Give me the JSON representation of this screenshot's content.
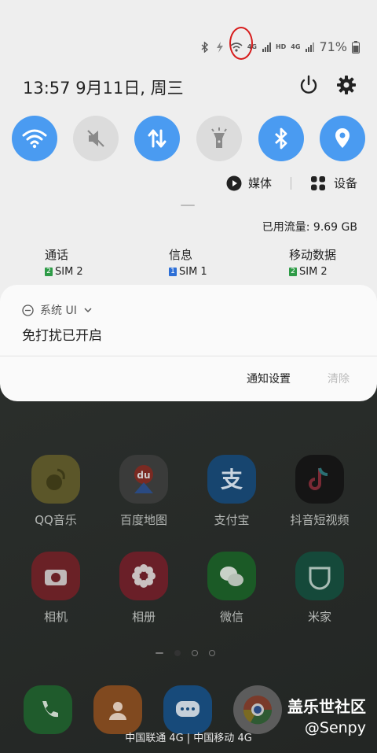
{
  "status_bar": {
    "battery_percent": "71%",
    "network_hd": "HD",
    "network_4g_1": "4G",
    "network_4g_2": "4G"
  },
  "header": {
    "time_date": "13:57  9月11日, 周三"
  },
  "quick_settings": [
    {
      "name": "wifi",
      "icon": "wifi-icon",
      "state": "on"
    },
    {
      "name": "sound",
      "icon": "mute-icon",
      "state": "off"
    },
    {
      "name": "mobile-data",
      "icon": "data-transfer-icon",
      "state": "on"
    },
    {
      "name": "flashlight",
      "icon": "flashlight-icon",
      "state": "off"
    },
    {
      "name": "bluetooth",
      "icon": "bluetooth-icon",
      "state": "on"
    },
    {
      "name": "location",
      "icon": "location-icon",
      "state": "on"
    }
  ],
  "media_row": {
    "media_label": "媒体",
    "devices_label": "设备"
  },
  "data_usage": "已用流量: 9.69 GB",
  "sim_settings": [
    {
      "label": "通话",
      "sim": "SIM 2",
      "badge": "2",
      "badge_color": "#2e9b47"
    },
    {
      "label": "信息",
      "sim": "SIM 1",
      "badge": "1",
      "badge_color": "#2d6fd6"
    },
    {
      "label": "移动数据",
      "sim": "SIM 2",
      "badge": "2",
      "badge_color": "#2e9b47"
    }
  ],
  "notification": {
    "app_name": "系统 UI",
    "message": "免打扰已开启",
    "settings_button": "通知设置",
    "clear_button": "清除"
  },
  "home_apps": [
    {
      "label": "QQ音乐",
      "color": "#e8c83c"
    },
    {
      "label": "百度地图",
      "color": "#f1f1f1"
    },
    {
      "label": "支付宝",
      "color": "#1b78e5"
    },
    {
      "label": "抖音短视频",
      "color": "#111111"
    },
    {
      "label": "相机",
      "color": "#e13b4a"
    },
    {
      "label": "相册",
      "color": "#d8334a"
    },
    {
      "label": "微信",
      "color": "#32c248"
    },
    {
      "label": "米家",
      "color": "#22a57d"
    }
  ],
  "dock": [
    {
      "icon": "phone-icon",
      "color": "#3aa351"
    },
    {
      "icon": "contacts-icon",
      "color": "#f0892f"
    },
    {
      "icon": "messages-icon",
      "color": "#2b86e6"
    },
    {
      "icon": "chrome-icon",
      "color": "#f2f2f2"
    }
  ],
  "carrier_text": "中国联通 4G | 中国移动 4G",
  "watermark": {
    "line1": "盖乐世社区",
    "line2": "@Senpy"
  },
  "colors": {
    "accent": "#4a9bf1",
    "shade_bg": "#eeeeee",
    "annotation": "#d71c1c"
  }
}
